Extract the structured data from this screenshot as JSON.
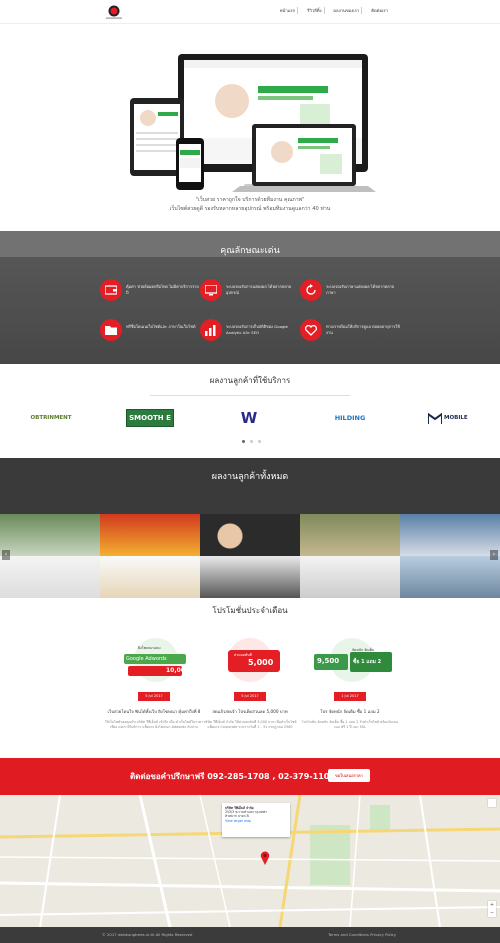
{
  "nav": {
    "items": [
      "หน้าแรก",
      "รีวิวลีทิ้ง",
      "ผลงานของเรา",
      "ติดต่อเรา"
    ]
  },
  "hero": {
    "tagline1": "\"เว็บสวย ราคาถูกใจ บริการด้วยทีมงาน คุณภาพ\"",
    "tagline2": "เว็บไซต์สวยดูดี รองรับหลากหลายอุปกรณ์ พร้อมทีมงานดูแลกว่า 40 ท่าน"
  },
  "features": {
    "title": "คุณลักษณะเด่น",
    "items": [
      {
        "icon": "wallet-icon",
        "text": "คุ้มค่า ช่วยย้อมดหรือไทย ไม่มีค่าบริการรายปี"
      },
      {
        "icon": "monitor-icon",
        "text": "ระบบรองรับการแสดงผล ได้หลากหลายอุปกรณ์"
      },
      {
        "icon": "refresh-icon",
        "text": "ระบบรองรับภาษาแสดงผล ได้หลากหลายภาษา"
      },
      {
        "icon": "folder-icon",
        "text": "ฟรีชื่อโดเมนเว็บไซต์และ ภาษาในเว็บไซต์"
      },
      {
        "icon": "chart-icon",
        "text": "ระบบรองรับการเก็บสถิติของ Google Analytic และ SEO"
      },
      {
        "icon": "heart-icon",
        "text": "ทางเราพร้อมให้บริการดูแล ตลอดอายุการใช้งาน"
      }
    ]
  },
  "clients": {
    "title": "ผลงานลูกค้าที่ใช้บริการ",
    "logos": [
      "OBTRINMENT",
      "SMOOTH E",
      "W",
      "HILDING",
      "MOBILE"
    ]
  },
  "works": {
    "title": "ผลงานลูกค้าทั้งหมด"
  },
  "promo": {
    "title": "โปรโมชั่นประจำเดือน",
    "cards": [
      {
        "date": "5 Jul 2017",
        "title": "เว็บสวยโดนใจ ฟินได้ทั้งเว็บ ยิงโฆษณา คุ้มค่าถึงที่ 8",
        "img_top": "ยิงโฆษณาแบบ",
        "img_brand": "Google Adwords",
        "img_price": "10,000",
        "body": "ให้เว็บไซต์ของคุณรับ บริษัท วีพีเอ็มส์ เข้าถึง เมื่อ ทำเว็บไซต์ในราคาเพียง แต่เราให้บริการ แพ็คเกจ ยิงโฆษณา Adwords กับท่าน"
      },
      {
        "date": "5 Jul 2017",
        "title": "สดแล้วสดเจ้า โปรเด็ดส่วนลด 5,000 บาท",
        "img_top": "ส่วนลดทันที",
        "img_brand": "",
        "img_price": "5,000",
        "body": "บริษัท วีพีเอ็มส์ จำกัด ให้ส่วนลดทันที 5,000 บาท เมื่อทำเว็บไซต์แพ็คเกจ Corporate ระหว่างวันที่ 1 - 31 กรกฎาคม 2560"
      },
      {
        "date": "1 Jul 2017",
        "title": "โปร จัดหนัก จัดเต็ม ซื้อ 1 แถม 2",
        "img_top": "จัดหนัก จัดเต็ม",
        "img_brand": "ซื้อ 1 แถม 2",
        "img_price": "9,500",
        "body": "โปรโมชั่น จัดหนัก จัดเต็ม ซื้อ 1 แถม 2 รับทำเว็บไซต์ พร้อมโดเมนเนม ฟรี 1 ปี และ SSL"
      }
    ]
  },
  "cta": {
    "text": "ติดต่อขอคำปรึกษาฟรี 092-285-1708 , 02-379-1102 หรือ",
    "button": "ขอใบเสนอราคา"
  },
  "map": {
    "card_title": "บริษัท วีพีเอ็มส์ จำกัด",
    "card_line1": "253/3 ซ.รามคำแหง กรุงเทพฯ",
    "card_line2": "หัวหมาก บางกะปิ",
    "card_link": "View larger map"
  },
  "footer": {
    "left": "© 2017 webkungtrees.in.th  All Rights Reserved",
    "right": "Terms and Conditions   Privacy Policy"
  },
  "colors": {
    "accent": "#e31e24",
    "dark": "#474747"
  }
}
